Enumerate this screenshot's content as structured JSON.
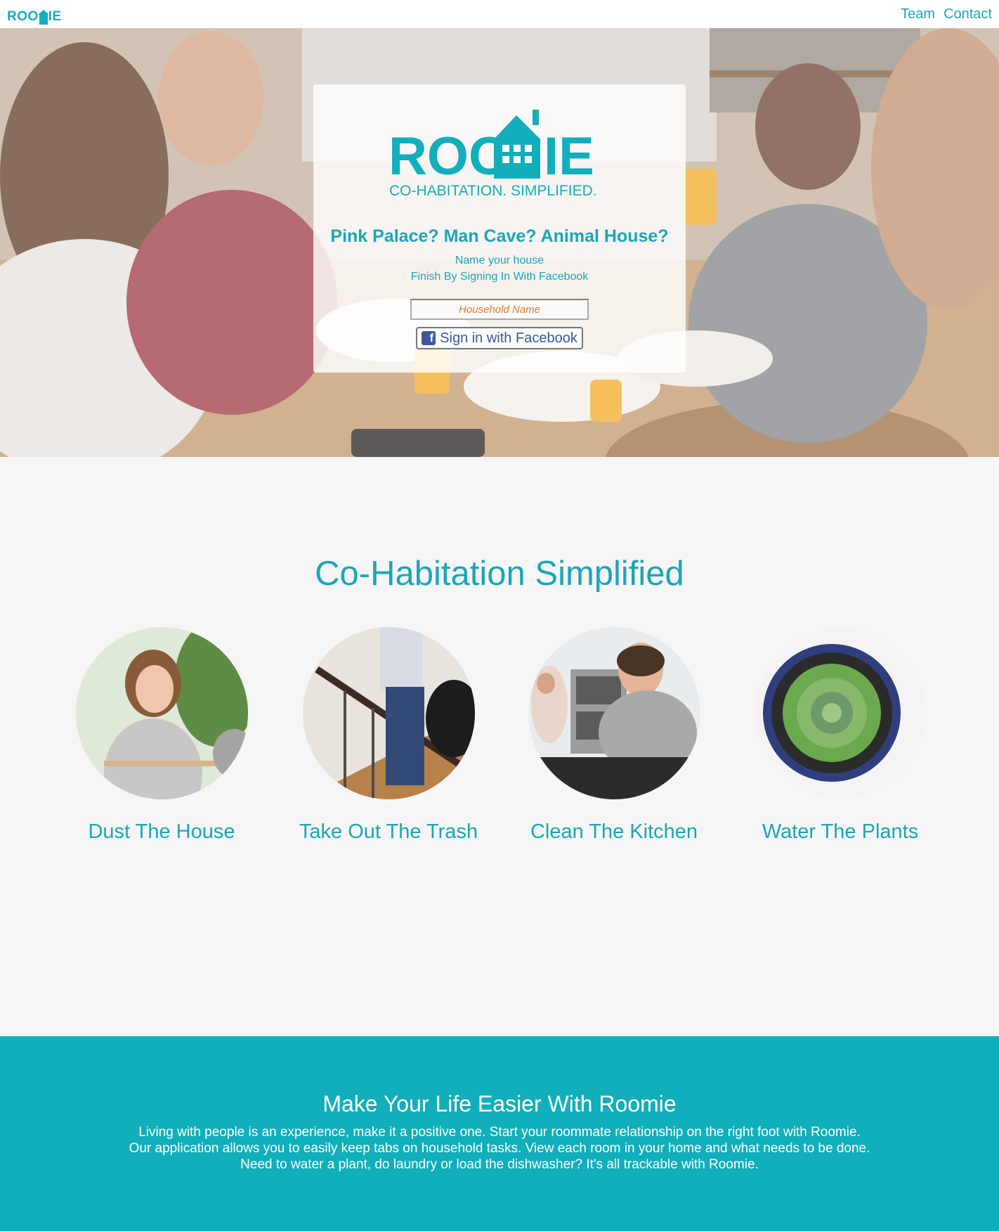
{
  "nav": {
    "logo_text": "ROOMIE",
    "links": [
      {
        "label": "Team"
      },
      {
        "label": "Contact"
      }
    ]
  },
  "hero": {
    "brand": "ROOMIE",
    "tagline": "CO-HABITATION. SIMPLIFIED.",
    "headline": "Pink Palace? Man Cave? Animal House?",
    "line1": "Name your house",
    "line2": "Finish By Signing In With Facebook",
    "input_placeholder": "Household Name",
    "facebook_button": "Sign in with Facebook"
  },
  "features": {
    "title": "Co-Habitation Simplified",
    "items": [
      {
        "label": "Dust The House",
        "image": "woman-dusting-photo"
      },
      {
        "label": "Take Out The Trash",
        "image": "trash-on-stairs-photo"
      },
      {
        "label": "Clean The Kitchen",
        "image": "kitchen-cleaning-photo"
      },
      {
        "label": "Water The Plants",
        "image": "succulent-plant-photo"
      }
    ]
  },
  "footer": {
    "title": "Make Your Life Easier With Roomie",
    "lines": [
      "Living with people is an experience, make it a positive one. Start your roommate relationship on the right foot with Roomie.",
      "Our application allows you to easily keep tabs on household tasks. View each room in your home and what needs to be done.",
      "Need to water a plant, do laundry or load the dishwasher? It's all trackable with Roomie."
    ]
  },
  "colors": {
    "brand_teal": "#12aebc",
    "text_teal": "#1aa6b7",
    "footer_bg": "#10afbb",
    "accent_orange": "#e37b2f",
    "facebook_blue": "#3b5998"
  }
}
